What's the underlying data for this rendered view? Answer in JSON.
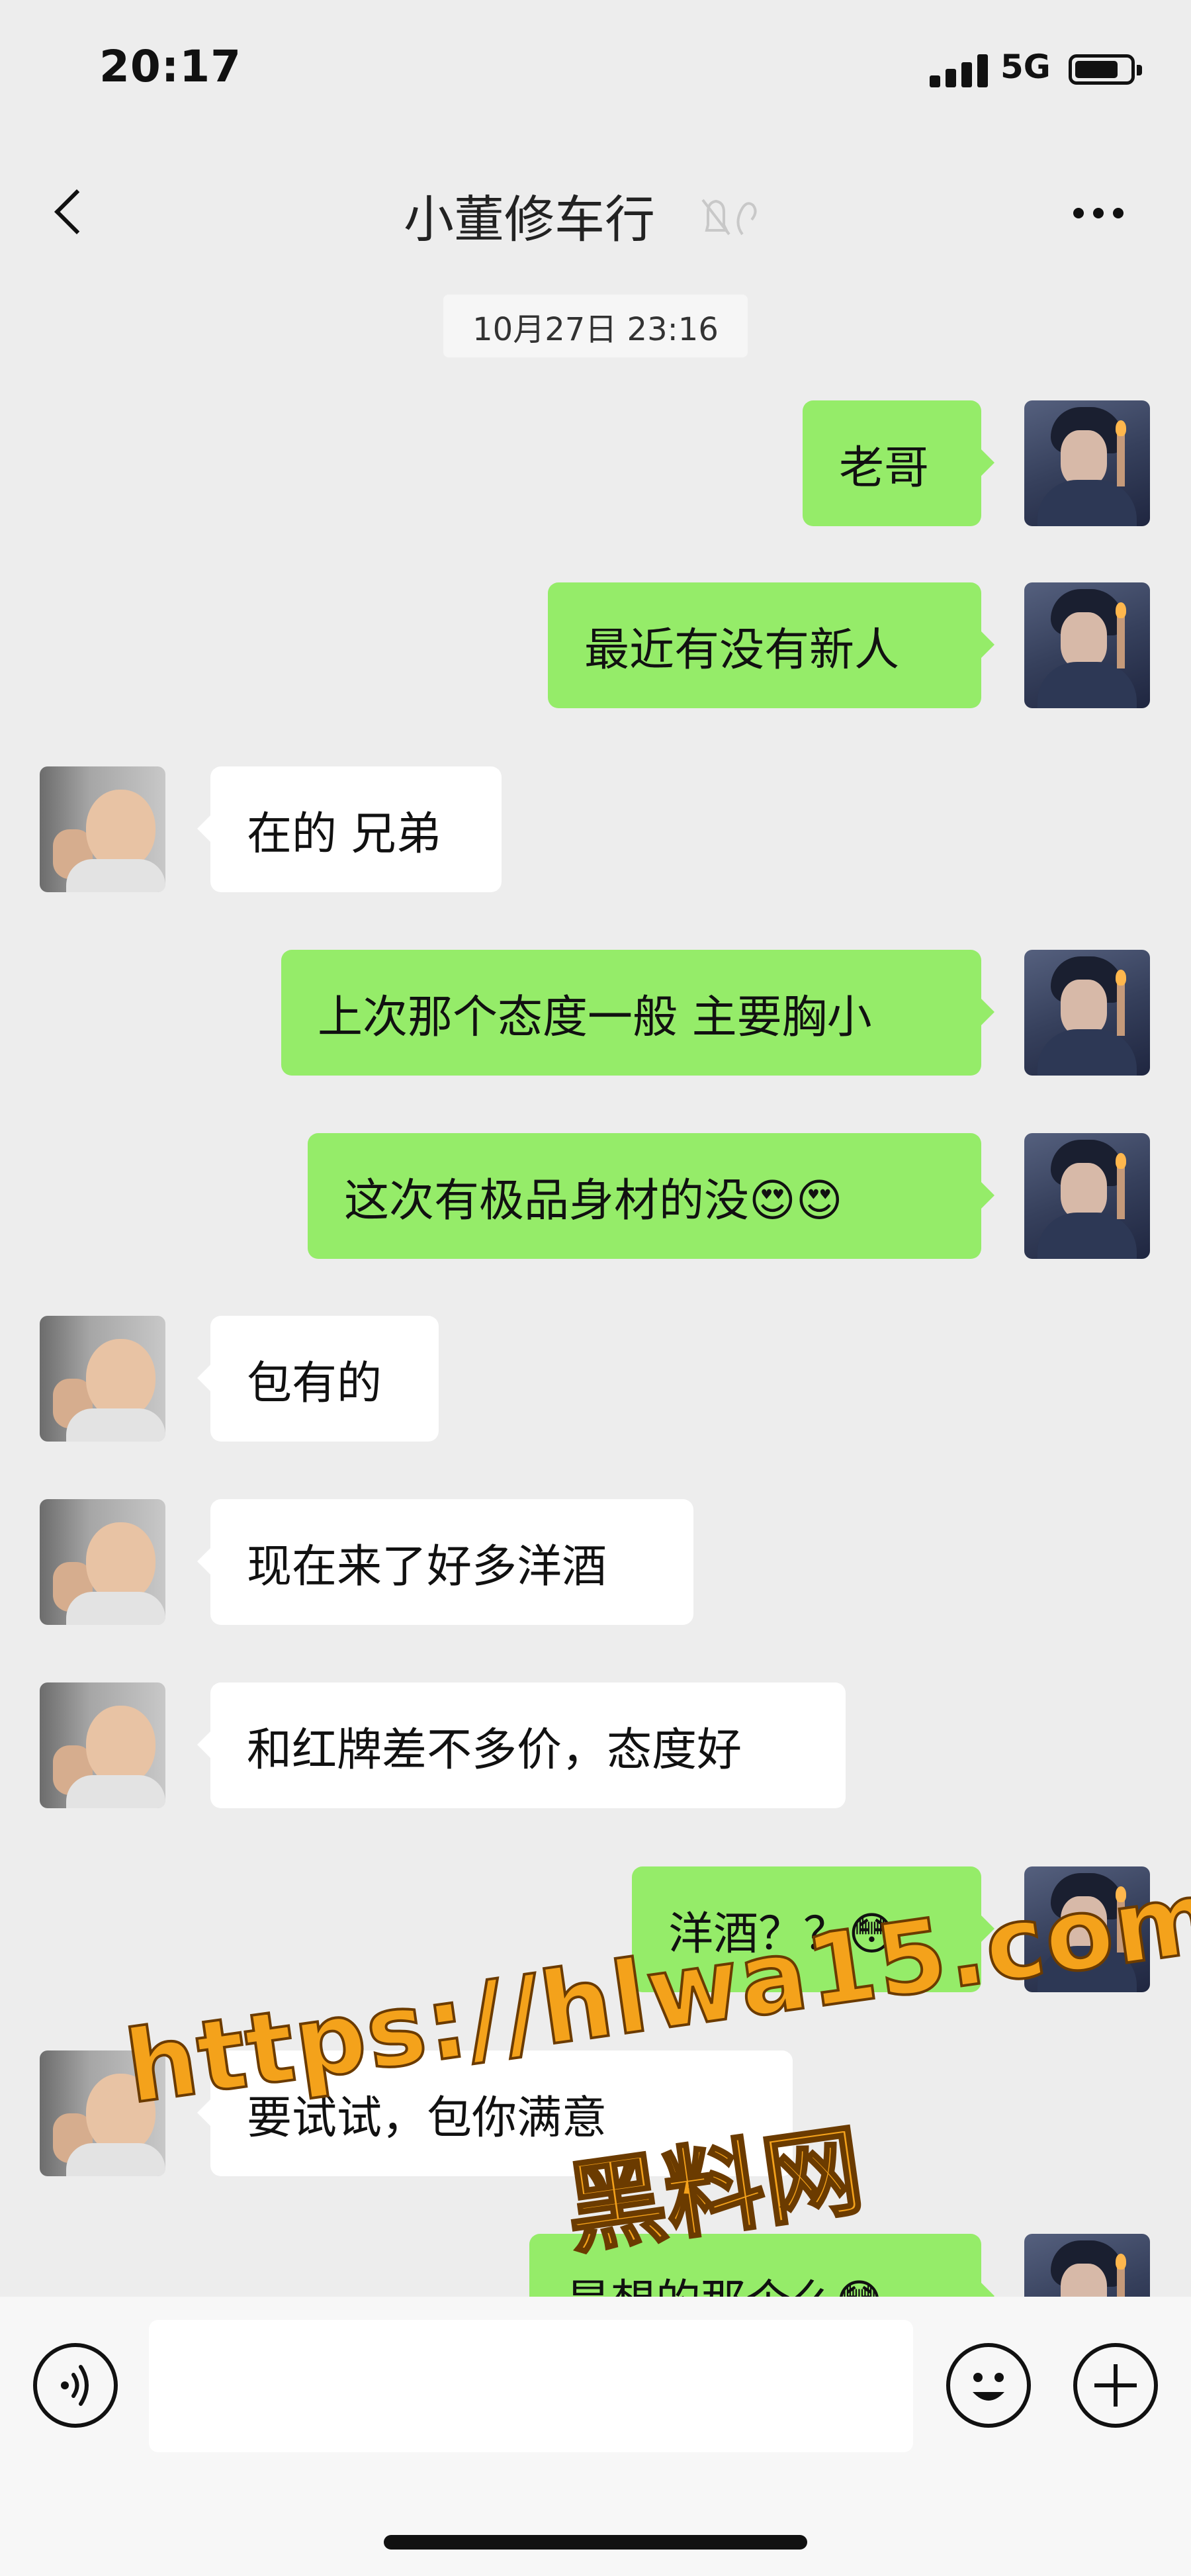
{
  "status_bar": {
    "time": "20:17",
    "network": "5G",
    "battery_level": 0.8
  },
  "header": {
    "back_icon": "chevron-left-icon",
    "title": "小董修车行",
    "mute_icon": "bell-slash-icon",
    "more_icon": "ellipsis-icon"
  },
  "chat": {
    "timestamp": "10月27日 23:16",
    "messages": [
      {
        "from": "me",
        "text": "老哥"
      },
      {
        "from": "me",
        "text": "最近有没有新人"
      },
      {
        "from": "them",
        "text": "在的 兄弟"
      },
      {
        "from": "me",
        "text": "上次那个态度一般 主要胸小"
      },
      {
        "from": "me",
        "text": "这次有极品身材的没😍😍"
      },
      {
        "from": "them",
        "text": "包有的"
      },
      {
        "from": "them",
        "text": "现在来了好多洋酒"
      },
      {
        "from": "them",
        "text": "和红牌差不多价，态度好"
      },
      {
        "from": "me",
        "text": "洋酒？？😳"
      },
      {
        "from": "them",
        "text": "要试试，包你满意"
      },
      {
        "from": "me",
        "text": "是想的那个么😳"
      }
    ]
  },
  "watermark": {
    "url": "https://hlwa15.com",
    "name": "黑料网"
  },
  "input_bar": {
    "voice_icon": "voice-icon",
    "emoji_icon": "emoji-icon",
    "plus_icon": "plus-icon"
  }
}
